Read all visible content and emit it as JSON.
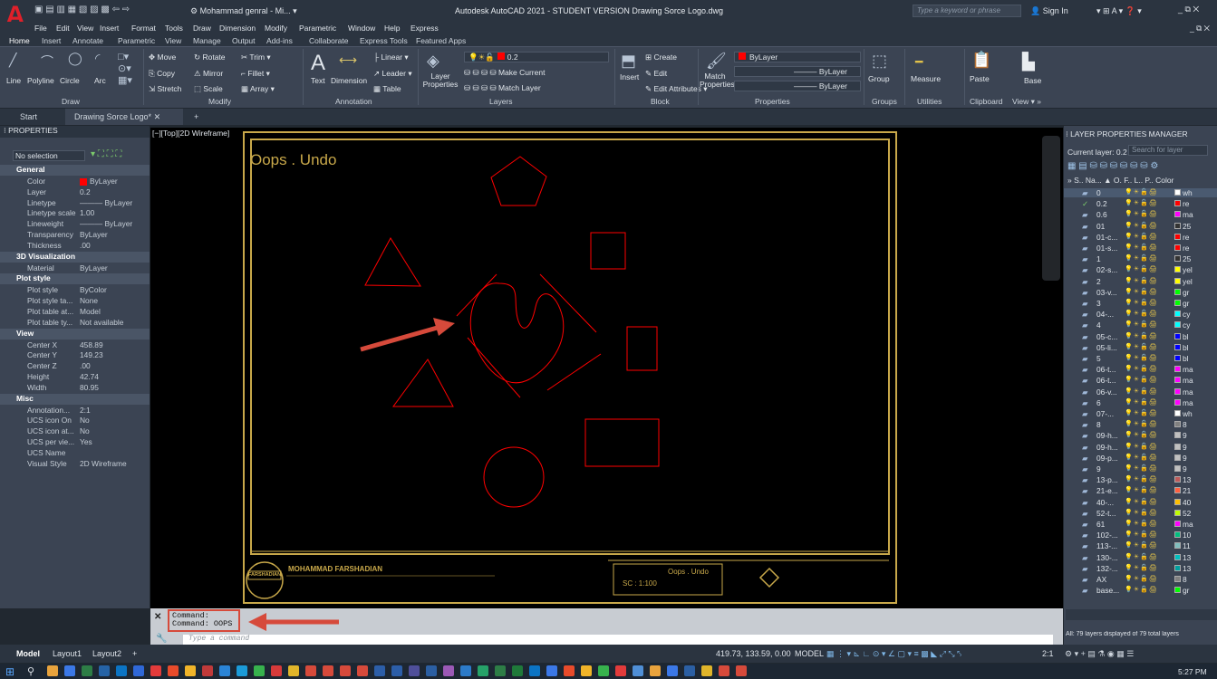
{
  "app": {
    "logo_letter": "A",
    "title": "Autodesk AutoCAD 2021 - STUDENT VERSION   Drawing Sorce Logo.dwg",
    "workspace": "Mohammad genral - Mi...",
    "search_placeholder": "Type a keyword or phrase",
    "sign_in": "Sign In"
  },
  "menu": [
    "File",
    "Edit",
    "View",
    "Insert",
    "Format",
    "Tools",
    "Draw",
    "Dimension",
    "Modify",
    "Parametric",
    "Window",
    "Help",
    "Express"
  ],
  "ribbon_tabs": [
    "Home",
    "Insert",
    "Annotate",
    "Parametric",
    "View",
    "Manage",
    "Output",
    "Add-ins",
    "Collaborate",
    "Express Tools",
    "Featured Apps"
  ],
  "ribbon": {
    "draw": {
      "line": "Line",
      "polyline": "Polyline",
      "circle": "Circle",
      "arc": "Arc",
      "panel": "Draw"
    },
    "modify": {
      "move": "Move",
      "rotate": "Rotate",
      "trim": "Trim",
      "copy": "Copy",
      "mirror": "Mirror",
      "fillet": "Fillet",
      "stretch": "Stretch",
      "scale": "Scale",
      "array": "Array",
      "panel": "Modify"
    },
    "annotation": {
      "text": "Text",
      "dimension": "Dimension",
      "linear": "Linear",
      "leader": "Leader",
      "table": "Table",
      "panel": "Annotation"
    },
    "layers": {
      "layer_properties": "Layer Properties",
      "layer_name": "0.2",
      "make_current": "Make Current",
      "match_layer": "Match Layer",
      "panel": "Layers"
    },
    "block": {
      "insert": "Insert",
      "create": "Create",
      "edit": "Edit",
      "edit_attributes": "Edit Attributes",
      "panel": "Block"
    },
    "properties": {
      "match": "Match Properties",
      "bylayer1": "ByLayer",
      "bylayer2": "ByLayer",
      "bylayer3": "ByLayer",
      "panel": "Properties"
    },
    "groups": {
      "group": "Group",
      "panel": "Groups"
    },
    "utilities": {
      "measure": "Measure",
      "panel": "Utilities"
    },
    "clipboard": {
      "paste": "Paste",
      "panel": "Clipboard"
    },
    "view": {
      "base": "Base",
      "panel": "View"
    }
  },
  "doc_tabs": [
    "Start",
    "Drawing Sorce Logo*"
  ],
  "properties_panel": {
    "title": "PROPERTIES",
    "selection": "No selection",
    "sections": [
      {
        "name": "General",
        "rows": [
          [
            "Color",
            "ByLayer"
          ],
          [
            "Layer",
            "0.2"
          ],
          [
            "Linetype",
            "——— ByLayer"
          ],
          [
            "Linetype scale",
            "1.00"
          ],
          [
            "Lineweight",
            "——— ByLayer"
          ],
          [
            "Transparency",
            "ByLayer"
          ],
          [
            "Thickness",
            ".00"
          ]
        ]
      },
      {
        "name": "3D Visualization",
        "rows": [
          [
            "Material",
            "ByLayer"
          ]
        ]
      },
      {
        "name": "Plot style",
        "rows": [
          [
            "Plot style",
            "ByColor"
          ],
          [
            "Plot style ta...",
            "None"
          ],
          [
            "Plot table at...",
            "Model"
          ],
          [
            "Plot table ty...",
            "Not available"
          ]
        ]
      },
      {
        "name": "View",
        "rows": [
          [
            "Center X",
            "458.89"
          ],
          [
            "Center Y",
            "149.23"
          ],
          [
            "Center Z",
            ".00"
          ],
          [
            "Height",
            "42.74"
          ],
          [
            "Width",
            "80.95"
          ]
        ]
      },
      {
        "name": "Misc",
        "rows": [
          [
            "Annotation...",
            "2:1"
          ],
          [
            "UCS icon On",
            "No"
          ],
          [
            "UCS icon at...",
            "No"
          ],
          [
            "UCS per vie...",
            "Yes"
          ],
          [
            "UCS Name",
            ""
          ],
          [
            "Visual Style",
            "2D Wireframe"
          ]
        ]
      }
    ]
  },
  "viewport_label": "[−][Top][2D Wireframe]",
  "drawing": {
    "title": "Oops . Undo",
    "block_title": "Oops . Undo",
    "scale": "SC : 1:100",
    "author": "MOHAMMAD FARSHADIAN",
    "brand": "FARSHADIAN"
  },
  "command": {
    "line1": "Command:",
    "line2": "Command: OOPS",
    "placeholder": "Type a command"
  },
  "layer_panel": {
    "title": "LAYER PROPERTIES MANAGER",
    "current": "Current layer: 0.2",
    "search": "Search for layer",
    "headers": "S.. Na... ▲ O. F.. L.. P.. Color",
    "footer": "All: 79 layers displayed of 79 total layers",
    "rows": [
      {
        "n": "0",
        "c": "wh",
        "col": "#ffffff"
      },
      {
        "n": "0.2",
        "c": "re",
        "col": "#ff0000"
      },
      {
        "n": "0.6",
        "c": "ma",
        "col": "#ff00ff"
      },
      {
        "n": "01",
        "c": "25",
        "col": "#333333"
      },
      {
        "n": "01-c...",
        "c": "re",
        "col": "#ff0000"
      },
      {
        "n": "01-s...",
        "c": "re",
        "col": "#ff0000"
      },
      {
        "n": "1",
        "c": "25",
        "col": "#333333"
      },
      {
        "n": "02-s...",
        "c": "yel",
        "col": "#ffff00"
      },
      {
        "n": "2",
        "c": "yel",
        "col": "#ffff00"
      },
      {
        "n": "03-v...",
        "c": "gr",
        "col": "#00ff00"
      },
      {
        "n": "3",
        "c": "gr",
        "col": "#00ff00"
      },
      {
        "n": "04-...",
        "c": "cy",
        "col": "#00ffff"
      },
      {
        "n": "4",
        "c": "cy",
        "col": "#00ffff"
      },
      {
        "n": "05-c...",
        "c": "bl",
        "col": "#0000ff"
      },
      {
        "n": "05-li...",
        "c": "bl",
        "col": "#0000ff"
      },
      {
        "n": "5",
        "c": "bl",
        "col": "#0000ff"
      },
      {
        "n": "06-t...",
        "c": "ma",
        "col": "#ff00ff"
      },
      {
        "n": "06-t...",
        "c": "ma",
        "col": "#ff00ff"
      },
      {
        "n": "06-v...",
        "c": "ma",
        "col": "#ff00ff"
      },
      {
        "n": "6",
        "c": "ma",
        "col": "#ff00ff"
      },
      {
        "n": "07-...",
        "c": "wh",
        "col": "#ffffff"
      },
      {
        "n": "8",
        "c": "8",
        "col": "#808080"
      },
      {
        "n": "09-h...",
        "c": "9",
        "col": "#c0c0c0"
      },
      {
        "n": "09-h...",
        "c": "9",
        "col": "#c0c0c0"
      },
      {
        "n": "09-p...",
        "c": "9",
        "col": "#c0c0c0"
      },
      {
        "n": "9",
        "c": "9",
        "col": "#c0c0c0"
      },
      {
        "n": "13-p...",
        "c": "13",
        "col": "#bd5a5a"
      },
      {
        "n": "21-e...",
        "c": "21",
        "col": "#ff5f3f"
      },
      {
        "n": "40-...",
        "c": "40",
        "col": "#ffbf00"
      },
      {
        "n": "52-t...",
        "c": "52",
        "col": "#bfff00"
      },
      {
        "n": "61",
        "c": "ma",
        "col": "#ff00ff"
      },
      {
        "n": "102-...",
        "c": "10",
        "col": "#00bf7f"
      },
      {
        "n": "113-...",
        "c": "11",
        "col": "#7fbfbf"
      },
      {
        "n": "130-...",
        "c": "13",
        "col": "#00bfbf"
      },
      {
        "n": "132-...",
        "c": "13",
        "col": "#009f9f"
      },
      {
        "n": "AX",
        "c": "8",
        "col": "#808080"
      },
      {
        "n": "base...",
        "c": "gr",
        "col": "#00ff00"
      }
    ]
  },
  "status": {
    "coords": "419.73, 133.59, 0.00",
    "model": "MODEL",
    "scale": "2:1",
    "model_tab": "Model",
    "layout1": "Layout1",
    "layout2": "Layout2",
    "time": "5:27 PM"
  },
  "colors": {
    "accent_red": "#d64a3b",
    "draw_red": "#ff0000",
    "frame_gold": "#c8a84a"
  }
}
